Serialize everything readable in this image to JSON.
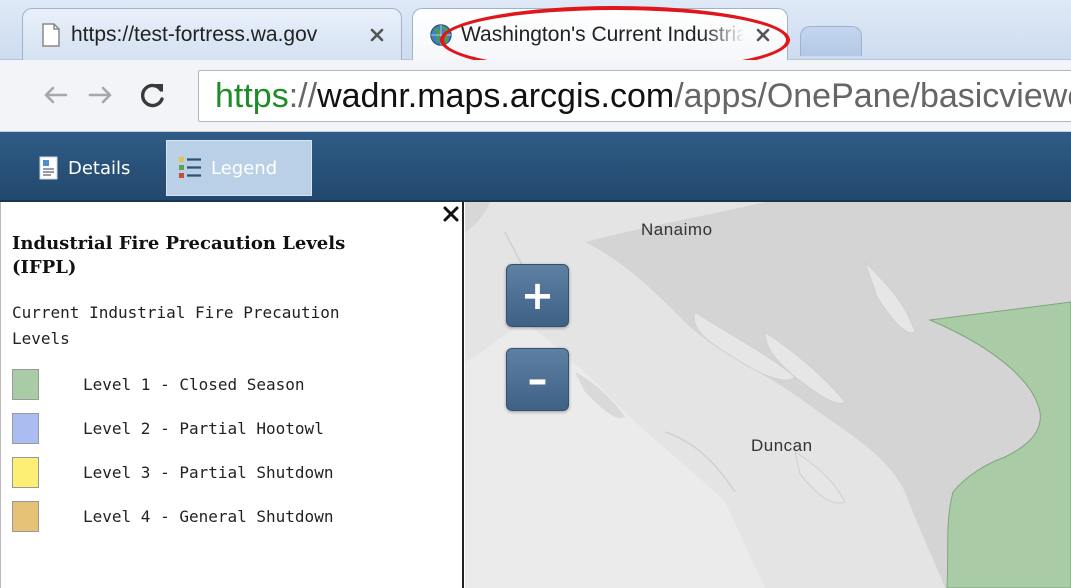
{
  "browser": {
    "tabs": [
      {
        "title": "https://test-fortress.wa.gov",
        "active": false
      },
      {
        "title": "Washington's Current Industrial Fire Precaution Levels",
        "active": true
      },
      {
        "title": "",
        "active": false
      }
    ],
    "url": {
      "scheme": "https",
      "separator": "://",
      "host": "wadnr.maps.arcgis.com",
      "path": "/apps/OnePane/basicviewer"
    }
  },
  "appbar": {
    "details_label": "Details",
    "legend_label": "Legend"
  },
  "legend": {
    "layer_title": "Industrial Fire Precaution Levels (IFPL)",
    "subtitle": "Current Industrial Fire Precaution Levels",
    "items": [
      {
        "label": "Level 1 - Closed Season",
        "color": "#a9cca6"
      },
      {
        "label": "Level 2 - Partial Hootowl",
        "color": "#aabcf0"
      },
      {
        "label": "Level 3 - Partial Shutdown",
        "color": "#fcef73"
      },
      {
        "label": "Level 4 - General Shutdown",
        "color": "#e6c277"
      }
    ]
  },
  "map": {
    "zoom_in": "+",
    "zoom_out": "–",
    "places": [
      "Nanaimo",
      "Duncan"
    ]
  },
  "colors": {
    "annotation_circle": "#e0161b",
    "appbar": "#2a527a",
    "ifpl_polygon": "#a9cca6"
  }
}
